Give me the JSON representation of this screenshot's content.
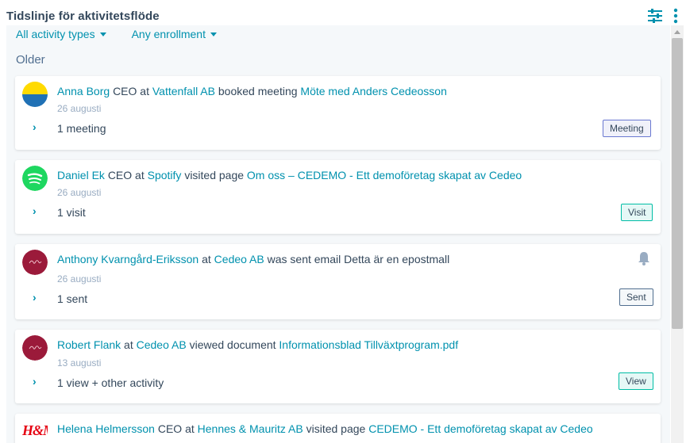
{
  "header": {
    "title": "Tidslinje för aktivitetsflöde",
    "filter_icon": "sliders-icon",
    "more_icon": "vertical-ellipsis-icon"
  },
  "filters": {
    "activity_types": "All activity types",
    "enrollment": "Any enrollment"
  },
  "group_label": "Older",
  "colors": {
    "link": "#0091ae",
    "text": "#33475b",
    "meeting_tag_border": "#6a78d1",
    "visit_tag_border": "#00bda5",
    "neutral_tag_border": "#516f90"
  },
  "cards": [
    {
      "avatar": "vattenfall-logo",
      "contact": "Anna Borg",
      "role": "CEO at",
      "company": "Vattenfall AB",
      "action": "booked meeting",
      "target": "Möte med Anders Cedeosson",
      "date": "26 augusti",
      "summary": "1 meeting",
      "tag": "Meeting"
    },
    {
      "avatar": "spotify-logo",
      "contact": "Daniel Ek",
      "role": "CEO at",
      "company": "Spotify",
      "action": "visited page",
      "target": "Om oss – CEDEMO - Ett demoföretag skapat av Cedeo",
      "date": "26 augusti",
      "summary": "1 visit",
      "tag": "Visit"
    },
    {
      "avatar": "cedeo-logo",
      "contact": "Anthony Kvarngård-Eriksson",
      "role": "at",
      "company": "Cedeo AB",
      "action": "was sent email Detta är en epostmall",
      "date": "26 augusti",
      "summary": "1 sent",
      "tag": "Sent",
      "icon": "bell-icon"
    },
    {
      "avatar": "cedeo-logo",
      "contact": "Robert Flank",
      "role": "at",
      "company": "Cedeo AB",
      "action": "viewed document",
      "target": "Informationsblad Tillväxtprogram.pdf",
      "date": "13 augusti",
      "summary": "1 view + other activity",
      "tag": "View"
    },
    {
      "avatar": "hm-logo",
      "avatar_text": "H&M",
      "contact": "Helena Helmersson",
      "role": "CEO at",
      "company": "Hennes & Mauritz AB",
      "action": "visited page",
      "target": "CEDEMO - Ett demoföretag skapat av Cedeo"
    }
  ]
}
